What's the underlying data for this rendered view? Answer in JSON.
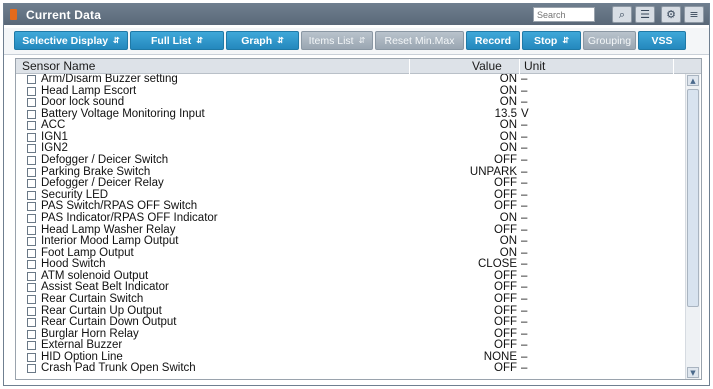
{
  "window": {
    "title": "Current Data"
  },
  "search": {
    "placeholder": "Search"
  },
  "toolbar_icons": [
    {
      "name": "search-list-icon",
      "glyph": "⌕"
    },
    {
      "name": "list-view-icon",
      "glyph": "☰"
    },
    {
      "name": "setting-icon",
      "glyph": "⚙"
    },
    {
      "name": "menu-icon",
      "glyph": "≡"
    }
  ],
  "buttons": {
    "selective_display": "Selective Display",
    "full_list": "Full List",
    "graph": "Graph",
    "items_list": "Items List",
    "reset_min_max": "Reset Min.Max",
    "record": "Record",
    "stop": "Stop",
    "grouping": "Grouping",
    "vss": "VSS"
  },
  "table": {
    "columns": {
      "name": "Sensor Name",
      "value": "Value",
      "unit": "Unit"
    },
    "rows": [
      {
        "name": "Arm/Disarm Buzzer setting",
        "value": "ON",
        "unit": "–"
      },
      {
        "name": "Head Lamp Escort",
        "value": "ON",
        "unit": "–"
      },
      {
        "name": "Door lock sound",
        "value": "ON",
        "unit": "–"
      },
      {
        "name": "Battery Voltage Monitoring Input",
        "value": "13.5",
        "unit": "V"
      },
      {
        "name": "ACC",
        "value": "ON",
        "unit": "–"
      },
      {
        "name": "IGN1",
        "value": "ON",
        "unit": "–"
      },
      {
        "name": "IGN2",
        "value": "ON",
        "unit": "–"
      },
      {
        "name": "Defogger / Deicer Switch",
        "value": "OFF",
        "unit": "–"
      },
      {
        "name": "Parking Brake Switch",
        "value": "UNPARK",
        "unit": "–"
      },
      {
        "name": "Defogger / Deicer Relay",
        "value": "OFF",
        "unit": "–"
      },
      {
        "name": "Security LED",
        "value": "OFF",
        "unit": "–"
      },
      {
        "name": "PAS Switch/RPAS OFF Switch",
        "value": "OFF",
        "unit": "–"
      },
      {
        "name": "PAS Indicator/RPAS OFF Indicator",
        "value": "ON",
        "unit": "–"
      },
      {
        "name": "Head Lamp Washer Relay",
        "value": "OFF",
        "unit": "–"
      },
      {
        "name": "Interior Mood Lamp Output",
        "value": "ON",
        "unit": "–"
      },
      {
        "name": "Foot Lamp Output",
        "value": "ON",
        "unit": "–"
      },
      {
        "name": "Hood Switch",
        "value": "CLOSE",
        "unit": "–"
      },
      {
        "name": "ATM solenoid Output",
        "value": "OFF",
        "unit": "–"
      },
      {
        "name": "Assist Seat Belt Indicator",
        "value": "OFF",
        "unit": "–"
      },
      {
        "name": "Rear Curtain Switch",
        "value": "OFF",
        "unit": "–"
      },
      {
        "name": "Rear Curtain Up Output",
        "value": "OFF",
        "unit": "–"
      },
      {
        "name": "Rear Curtain Down Output",
        "value": "OFF",
        "unit": "–"
      },
      {
        "name": "Burglar Horn Relay",
        "value": "OFF",
        "unit": "–"
      },
      {
        "name": "External Buzzer",
        "value": "OFF",
        "unit": "–"
      },
      {
        "name": "HID Option Line",
        "value": "NONE",
        "unit": "–"
      },
      {
        "name": "Crash Pad Trunk Open Switch",
        "value": "OFF",
        "unit": "–"
      }
    ]
  },
  "scrollbar": {
    "up_glyph": "▲",
    "down_glyph": "▼"
  }
}
